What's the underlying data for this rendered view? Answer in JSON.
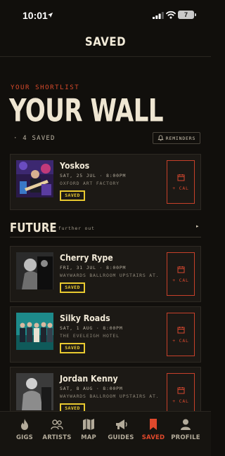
{
  "status_bar": {
    "time": "10:01",
    "battery": "7"
  },
  "nav": {
    "title": "SAVED"
  },
  "header": {
    "kicker": "YOUR SHORTLIST",
    "title": "YOUR WALL"
  },
  "summary": {
    "count_text": "· 4 SAVED",
    "reminders_label": "REMINDERS"
  },
  "upcoming": [
    {
      "name": "Yoskos",
      "date": "SAT, 25 JUL · 8:00PM",
      "venue": "OXFORD ART FACTORY",
      "badge": "SAVED",
      "cal_label": "+ CAL"
    }
  ],
  "future_section": {
    "title": "FUTURE",
    "meta": "3 · further out",
    "events": [
      {
        "name": "Cherry Rype",
        "date": "FRI, 31 JUL · 8:00PM",
        "venue": "WAYWARDS BALLROOM UPSTAIRS AT...",
        "badge": "SAVED",
        "cal_label": "+ CAL"
      },
      {
        "name": "Silky Roads",
        "date": "SAT, 1 AUG · 8:00PM",
        "venue": "THE EVELEIGH HOTEL",
        "badge": "SAVED",
        "cal_label": "+ CAL"
      },
      {
        "name": "Jordan Kenny",
        "date": "SAT, 8 AUG · 8:00PM",
        "venue": "WAYWARDS BALLROOM UPSTAIRS AT...",
        "badge": "SAVED",
        "cal_label": "+ CAL"
      }
    ]
  },
  "tab_bar": [
    {
      "label": "GIGS",
      "icon": "flame-icon"
    },
    {
      "label": "ARTISTS",
      "icon": "people-icon"
    },
    {
      "label": "MAP",
      "icon": "map-icon"
    },
    {
      "label": "GUIDES",
      "icon": "megaphone-icon"
    },
    {
      "label": "SAVED",
      "icon": "bookmark-icon",
      "active": true
    },
    {
      "label": "PROFILE",
      "icon": "person-icon"
    }
  ],
  "colors": {
    "background": "#110f0c",
    "accent": "#d84a2b",
    "badge": "#e8c930",
    "text": "#efe6d2"
  }
}
